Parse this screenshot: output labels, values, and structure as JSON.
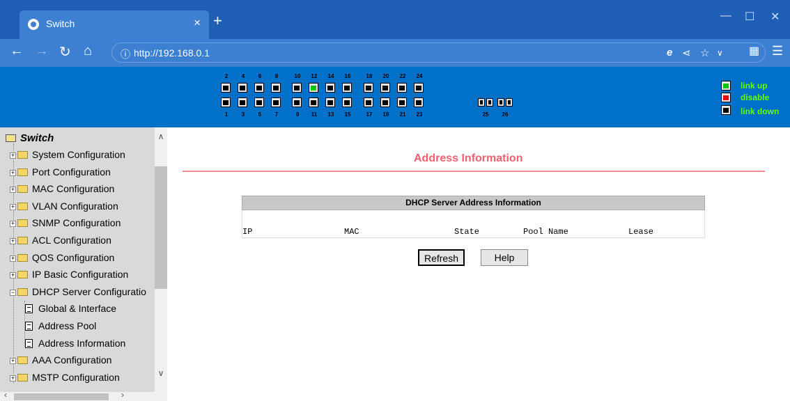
{
  "browser": {
    "tab_title": "Switch",
    "url": "http://192.168.0.1",
    "new_tab_label": "+",
    "tab_close_label": "×"
  },
  "banner": {
    "top_port_numbers": [
      "2",
      "4",
      "6",
      "8",
      "10",
      "12",
      "14",
      "16",
      "18",
      "20",
      "22",
      "24"
    ],
    "bottom_port_numbers": [
      "1",
      "3",
      "5",
      "7",
      "9",
      "11",
      "13",
      "15",
      "17",
      "19",
      "21",
      "23"
    ],
    "sfp_port_numbers": [
      "25",
      "26"
    ],
    "port_up": "12",
    "legend": {
      "link_up": "link up",
      "disable": "disable",
      "link_down": "link down",
      "colors": {
        "link_up": "#00c800",
        "disable": "#ee0000",
        "link_down": "#000000"
      }
    }
  },
  "sidebar": {
    "root_label": "Switch",
    "items": [
      {
        "label": "System Configuration",
        "type": "folder",
        "expanded": false
      },
      {
        "label": "Port Configuration",
        "type": "folder",
        "expanded": false
      },
      {
        "label": "MAC Configuration",
        "type": "folder",
        "expanded": false
      },
      {
        "label": "VLAN Configuration",
        "type": "folder",
        "expanded": false
      },
      {
        "label": "SNMP Configuration",
        "type": "folder",
        "expanded": false
      },
      {
        "label": "ACL Configuration",
        "type": "folder",
        "expanded": false
      },
      {
        "label": "QOS Configuration",
        "type": "folder",
        "expanded": false
      },
      {
        "label": "IP Basic Configuration",
        "type": "folder",
        "expanded": false
      },
      {
        "label": "DHCP Server Configuratio",
        "type": "folder",
        "expanded": true
      },
      {
        "label": "Global & Interface",
        "type": "page"
      },
      {
        "label": "Address Pool",
        "type": "page"
      },
      {
        "label": "Address Information",
        "type": "page"
      },
      {
        "label": "AAA Configuration",
        "type": "folder",
        "expanded": false
      },
      {
        "label": "MSTP Configuration",
        "type": "folder",
        "expanded": false
      }
    ]
  },
  "main": {
    "title": "Address Information",
    "table": {
      "caption": "DHCP Server Address Information",
      "columns": [
        "IP",
        "MAC",
        "State",
        "Pool Name",
        "Lease"
      ]
    },
    "buttons": {
      "refresh": "Refresh",
      "help": "Help"
    }
  }
}
